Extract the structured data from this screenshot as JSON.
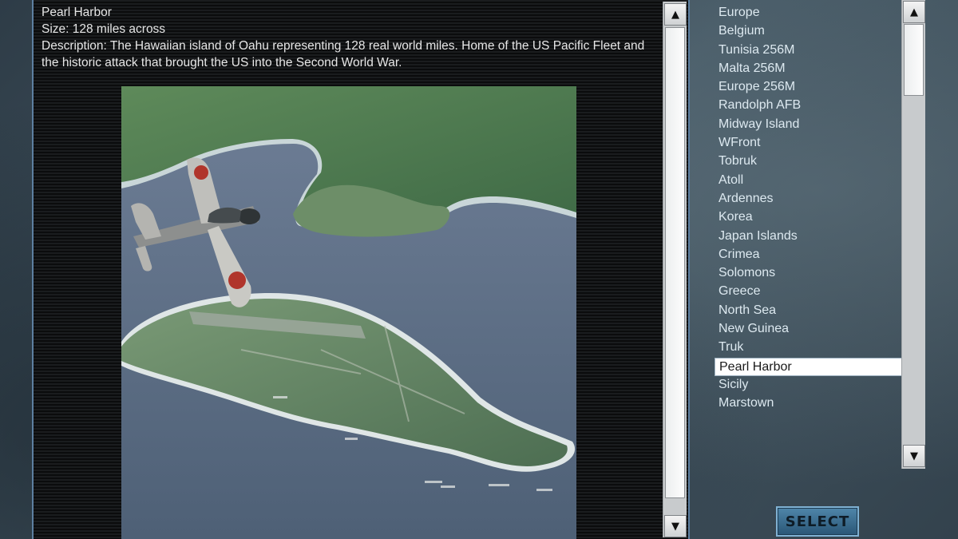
{
  "map_info": {
    "name": "Pearl Harbor",
    "size": "Size: 128 miles across",
    "description": "Description: The Hawaiian island of Oahu representing 128 real world miles. Home of the US Pacific Fleet and the historic attack that brought the US into the Second World War."
  },
  "map_list": {
    "items": [
      "Europe",
      "Belgium",
      "Tunisia 256M",
      "Malta 256M",
      "Europe 256M",
      "Randolph AFB",
      "Midway Island",
      "WFront",
      "Tobruk",
      "Atoll",
      "Ardennes",
      "Korea",
      "Japan Islands",
      "Crimea",
      "Solomons",
      "Greece",
      "North Sea",
      "New Guinea",
      "Truk",
      "Pearl Harbor",
      "Sicily",
      "Marstown"
    ],
    "selected": "Pearl Harbor"
  },
  "select_button": {
    "label": "SELECT"
  },
  "icons": {
    "scroll_up": "▲",
    "scroll_down": "▼"
  },
  "colors": {
    "list_text": "#dde9f0",
    "selected_bg": "#ffffff",
    "panel_border": "#5d7fa0"
  }
}
